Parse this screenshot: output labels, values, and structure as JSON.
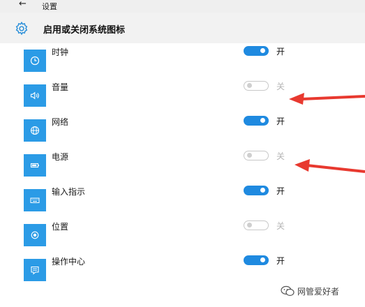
{
  "titlebar": {
    "title": "设置"
  },
  "header": {
    "title": "启用或关闭系统图标"
  },
  "items": [
    {
      "label": "时钟",
      "icon": "clock-icon",
      "on": true,
      "state": "开"
    },
    {
      "label": "音量",
      "icon": "speaker-icon",
      "on": false,
      "state": "关"
    },
    {
      "label": "网络",
      "icon": "globe-icon",
      "on": true,
      "state": "开"
    },
    {
      "label": "电源",
      "icon": "battery-icon",
      "on": false,
      "state": "关"
    },
    {
      "label": "输入指示",
      "icon": "keyboard-icon",
      "on": true,
      "state": "开"
    },
    {
      "label": "位置",
      "icon": "location-icon",
      "on": false,
      "state": "关"
    },
    {
      "label": "操作中心",
      "icon": "action-center-icon",
      "on": true,
      "state": "开"
    }
  ],
  "watermark": {
    "text": "网管爱好者"
  },
  "colors": {
    "accent": "#1f8ae0",
    "tile": "#2b9be6",
    "arrow": "#e8392f"
  }
}
